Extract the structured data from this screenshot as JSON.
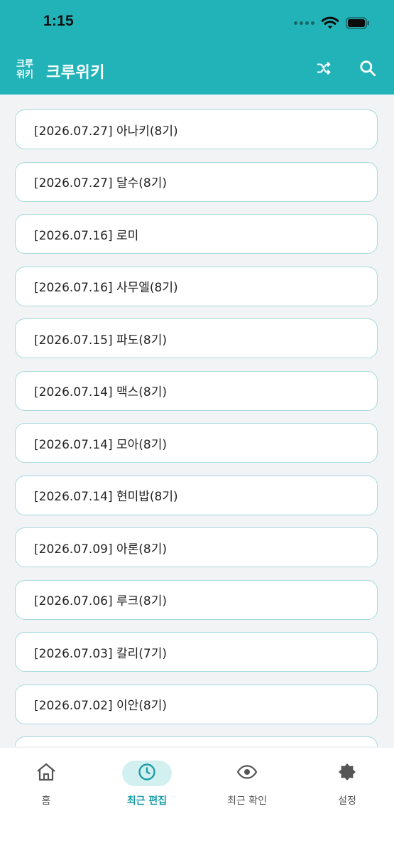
{
  "status_bar": {
    "time": "1:15",
    "icons": [
      "signal-icon",
      "wifi-icon",
      "battery-icon"
    ]
  },
  "header": {
    "logo_line1": "크루",
    "logo_line2": "위키",
    "title": "크루위키",
    "background_color": "#22B3B8",
    "actions": [
      "shuffle-icon",
      "search-icon"
    ]
  },
  "recent_edits": [
    "[2026.07.27] 아나키(8기)",
    "[2026.07.27] 달수(8기)",
    "[2026.07.16] 로미",
    "[2026.07.16] 사무엘(8기)",
    "[2026.07.15] 파도(8기)",
    "[2026.07.14] 맥스(8기)",
    "[2026.07.14] 모아(8기)",
    "[2026.07.14] 현미밥(8기)",
    "[2026.07.09] 아론(8기)",
    "[2026.07.06] 루크(8기)",
    "[2026.07.03] 칼리(7기)",
    "[2026.07.02] 이안(8기)",
    ""
  ],
  "bottom_nav": {
    "active_color": "#1A9FA5",
    "items": [
      {
        "label": "홈",
        "icon": "home-icon",
        "active": false
      },
      {
        "label": "최근 편집",
        "icon": "clock-icon",
        "active": true
      },
      {
        "label": "최근 확인",
        "icon": "eye-icon",
        "active": false
      },
      {
        "label": "설정",
        "icon": "settings-icon",
        "active": false
      }
    ]
  }
}
